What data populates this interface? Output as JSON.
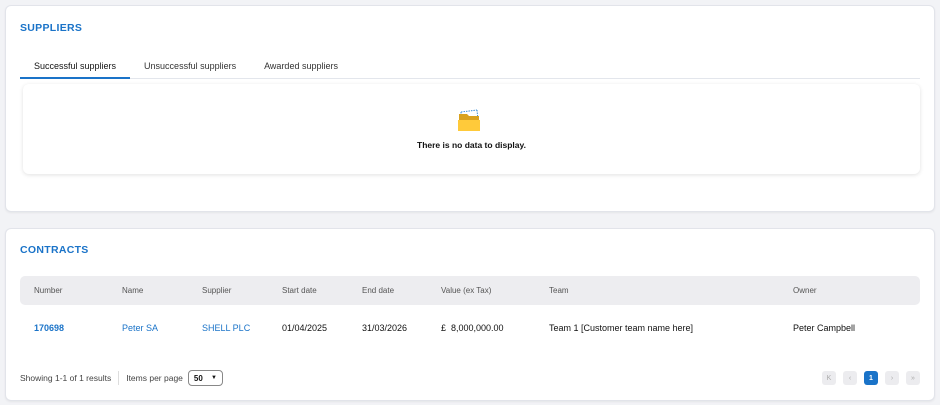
{
  "suppliers": {
    "title": "SUPPLIERS",
    "tabs": [
      {
        "label": "Successful suppliers",
        "active": true
      },
      {
        "label": "Unsuccessful suppliers"
      },
      {
        "label": "Awarded suppliers"
      }
    ],
    "empty_message": "There is no data to display.",
    "empty_icon": "folder-icon"
  },
  "contracts": {
    "title": "CONTRACTS",
    "columns": [
      "Number",
      "Name",
      "Supplier",
      "Start date",
      "End date",
      "Value (ex Tax)",
      "Team",
      "Owner"
    ],
    "rows": [
      {
        "number": "170698",
        "name": "Peter SA",
        "supplier": "SHELL PLC",
        "start": "01/04/2025",
        "end": "31/03/2026",
        "value": "£  8,000,000.00",
        "team": "Team 1 [Customer team name here]",
        "owner": "Peter Campbell"
      }
    ],
    "footer": {
      "showing": "Showing 1-1 of 1 results",
      "items_per_page_label": "Items per page",
      "items_per_page": "50",
      "current_page": "1",
      "first": "K",
      "prev": "‹",
      "next": "›",
      "last": "»"
    }
  },
  "colors": {
    "accent": "#1a73c8"
  }
}
